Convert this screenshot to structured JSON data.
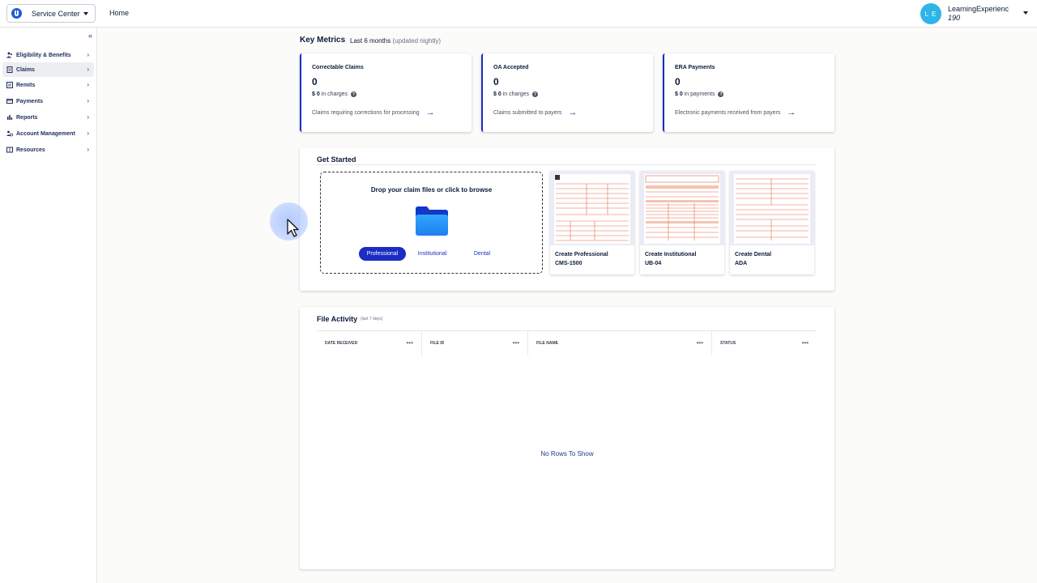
{
  "header": {
    "service_label": "Service Center",
    "home_label": "Home",
    "avatar_initials": "L E",
    "user_name": "LearningExperienc",
    "user_id": "190"
  },
  "sidebar": {
    "collapse_glyph": "«",
    "items": [
      {
        "label": "Eligibility & Benefits",
        "icon": "people-icon",
        "active": false
      },
      {
        "label": "Claims",
        "icon": "document-icon",
        "active": true
      },
      {
        "label": "Remits",
        "icon": "receipt-icon",
        "active": false
      },
      {
        "label": "Payments",
        "icon": "card-icon",
        "active": false
      },
      {
        "label": "Reports",
        "icon": "bar-chart-icon",
        "active": false
      },
      {
        "label": "Account Management",
        "icon": "users-gear-icon",
        "active": false
      },
      {
        "label": "Resources",
        "icon": "book-icon",
        "active": false
      }
    ]
  },
  "key_metrics": {
    "title": "Key Metrics",
    "period": "Last 6 months",
    "updated": "(updated nightly)",
    "cards": [
      {
        "title": "Correctable Claims",
        "value": "0",
        "amount": "$ 0",
        "amount_suffix": "in charges",
        "description": "Claims requiring corrections for processing"
      },
      {
        "title": "OA Accepted",
        "value": "0",
        "amount": "$ 0",
        "amount_suffix": "in charges",
        "description": "Claims submitted to payers"
      },
      {
        "title": "ERA Payments",
        "value": "0",
        "amount": "$ 0",
        "amount_suffix": "in payments",
        "description": "Electronic payments received from payers"
      }
    ]
  },
  "get_started": {
    "title": "Get Started",
    "dropzone_text": "Drop your claim files or click to browse",
    "segments": [
      "Professional",
      "Institutional",
      "Dental"
    ],
    "active_segment": "Professional",
    "forms": [
      {
        "title": "Create Professional",
        "code": "CMS-1500"
      },
      {
        "title": "Create Institutional",
        "code": "UB-04"
      },
      {
        "title": "Create Dental",
        "code": "ADA"
      }
    ]
  },
  "file_activity": {
    "title": "File Activity",
    "subtitle": "(last 7 days)",
    "columns": [
      "DATE RECEIVED",
      "FILE ID",
      "FILE NAME",
      "STATUS"
    ],
    "empty_text": "No Rows To Show"
  },
  "colors": {
    "accent": "#1b2dc2",
    "avatar": "#2eb5e8",
    "form_lines": "#e8694a"
  }
}
